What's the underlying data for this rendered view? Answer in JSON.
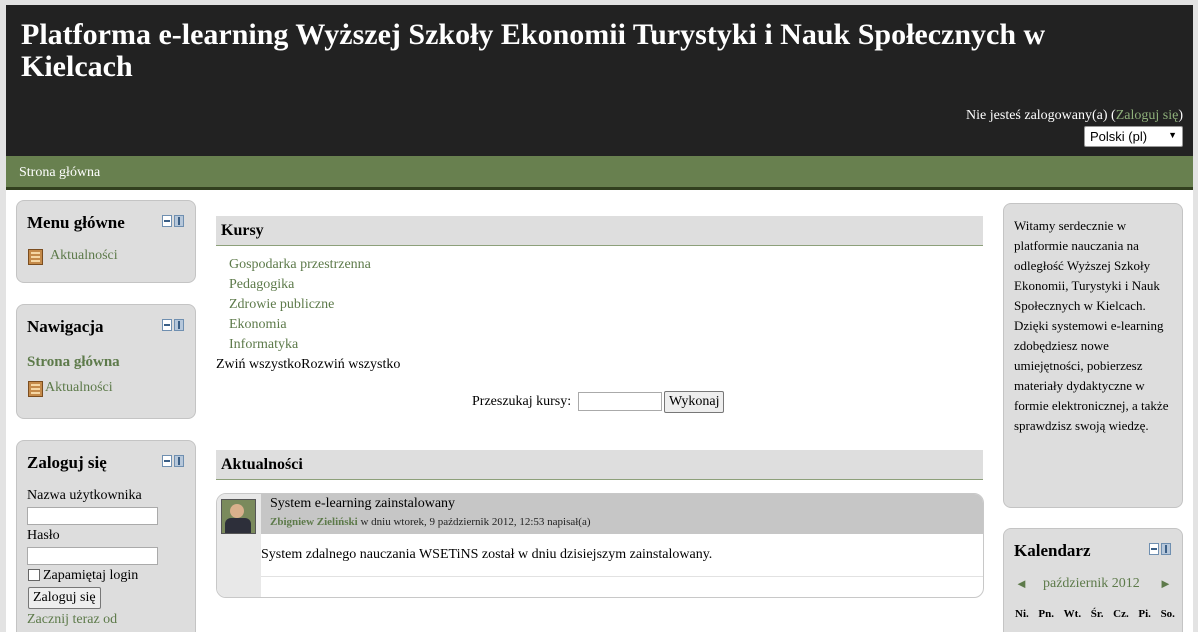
{
  "header": {
    "site_title": "Platforma e-learning Wyższej Szkoły Ekonomii Turystyki i Nauk Społecznych w Kielcach",
    "login_status": "Nie jesteś zalogowany(a)",
    "login_link": "Zaloguj się",
    "language": "Polski (pl)"
  },
  "navbar": {
    "home": "Strona główna"
  },
  "left": {
    "main_menu": {
      "title": "Menu główne",
      "items": [
        "Aktualności"
      ]
    },
    "navigation": {
      "title": "Nawigacja",
      "home": "Strona główna",
      "items": [
        "Aktualności"
      ]
    },
    "login": {
      "title": "Zaloguj się",
      "username_label": "Nazwa użytkownika",
      "username_value": "",
      "password_label": "Hasło",
      "remember_label": "Zapamiętaj login",
      "submit_label": "Zaloguj się",
      "start_link": "Zacznij teraz od"
    }
  },
  "main": {
    "courses": {
      "title": "Kursy",
      "items": [
        "Gospodarka przestrzenna",
        "Pedagogika",
        "Zdrowie publiczne",
        "Ekonomia",
        "Informatyka"
      ],
      "collapse_all": "Zwiń wszystko",
      "expand_all": "Rozwiń wszystko",
      "search_label": "Przeszukaj kursy:",
      "search_value": "",
      "search_button": "Wykonaj"
    },
    "news": {
      "title": "Aktualności",
      "post": {
        "subject": "System e-learning zainstalowany",
        "author": "Zbigniew Zieliński",
        "meta": "w dniu wtorek, 9 październik 2012, 12:53 napisał(a)",
        "body": "System zdalnego nauczania WSETiNS został w dniu dzisiejszym zainstalowany."
      }
    }
  },
  "right": {
    "welcome_text": "Witamy serdecznie w platformie nauczania na odległość Wyższej Szkoły Ekonomii, Turystyki i Nauk Społecznych w Kielcach. Dzięki systemowi e-learning zdobędziesz nowe umiejętności, pobierzesz materiały dydaktyczne w formie elektronicznej, a także sprawdzisz swoją wiedzę.",
    "calendar": {
      "title": "Kalendarz",
      "month": "październik 2012",
      "prev": "◄",
      "next": "►",
      "weekdays": [
        "Ni.",
        "Pn.",
        "Wt.",
        "Śr.",
        "Cz.",
        "Pi.",
        "So."
      ]
    }
  },
  "colors": {
    "header_bg": "#222222",
    "nav_bg": "#68804f",
    "link": "#5d7a4a",
    "block_bg": "#dddddd"
  }
}
